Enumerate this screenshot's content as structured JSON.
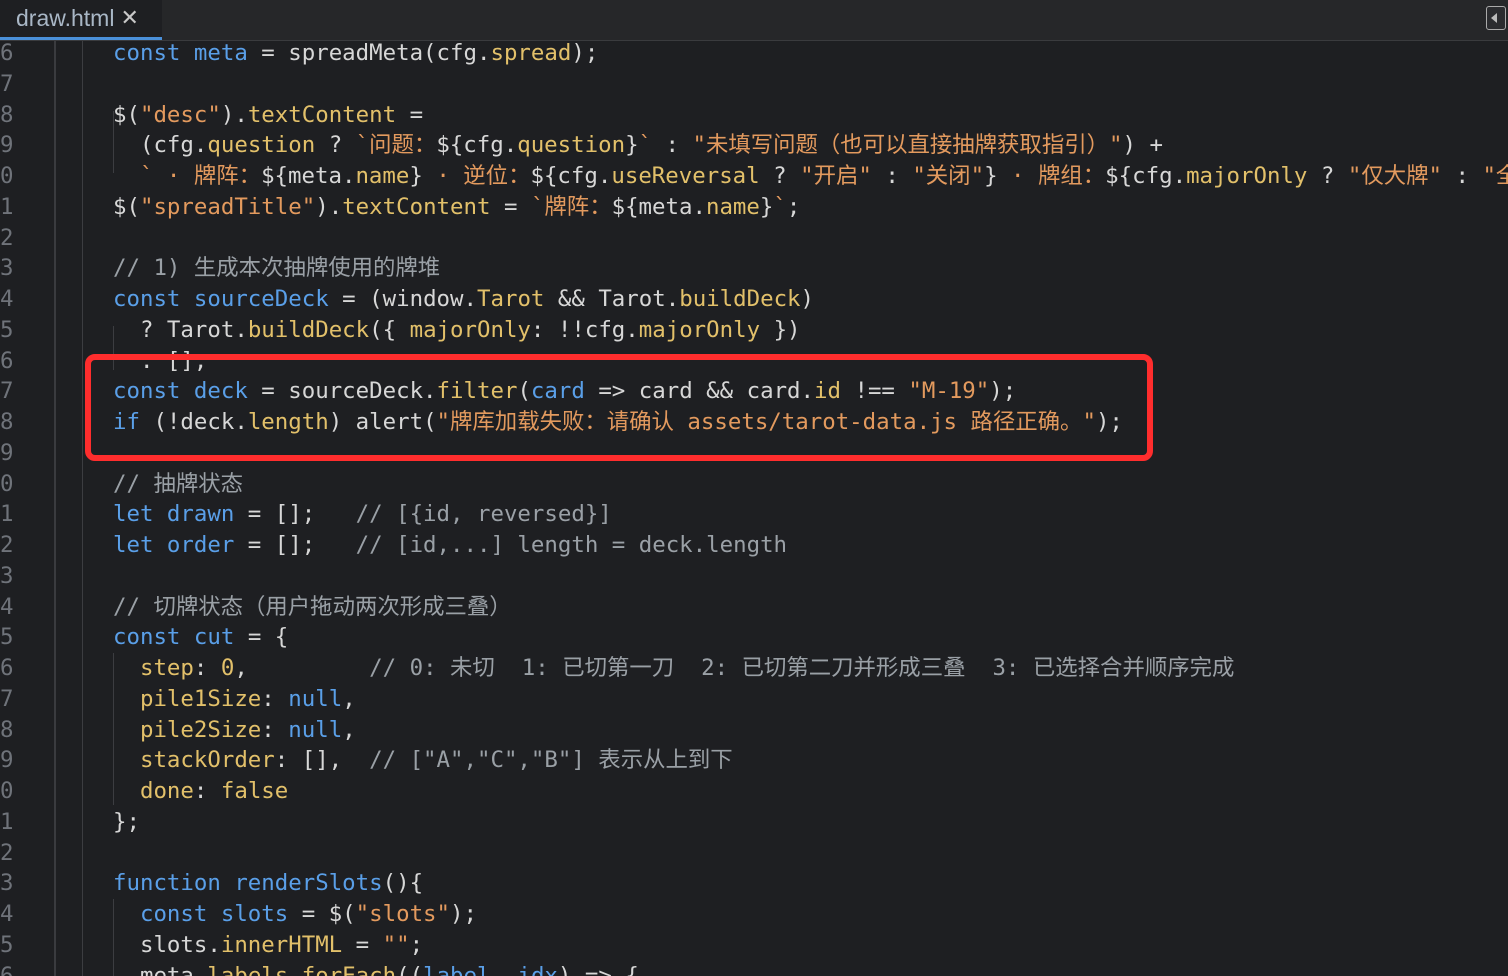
{
  "tab": {
    "title": "draw.html",
    "close_glyph": "✕"
  },
  "panel_toggle_icon": "collapse-panel-icon",
  "colors": {
    "background": "#1e1f22",
    "keyword": "#5a9fe8",
    "property": "#e2c06a",
    "string": "#e39a5e",
    "comment": "#9aa0a6",
    "text": "#d7d7d7",
    "highlight_box": "#ff2d2d"
  },
  "highlight": {
    "covers_line_numbers": [
      "7",
      "8"
    ],
    "color": "#ff2d2d"
  },
  "lines": [
    {
      "n": "6",
      "tokens": [
        [
          "kw",
          "const "
        ],
        [
          "var",
          "meta"
        ],
        [
          "txt",
          " = spreadMeta(cfg."
        ],
        [
          "prop",
          "spread"
        ],
        [
          "txt",
          ");"
        ]
      ]
    },
    {
      "n": "7",
      "tokens": []
    },
    {
      "n": "8",
      "tokens": [
        [
          "txt",
          "$("
        ],
        [
          "str",
          "\"desc\""
        ],
        [
          "txt",
          ")."
        ],
        [
          "prop",
          "textContent"
        ],
        [
          "txt",
          " ="
        ]
      ]
    },
    {
      "n": "9",
      "tokens": [
        [
          "txt",
          "  (cfg."
        ],
        [
          "prop",
          "question"
        ],
        [
          "txt",
          " ? "
        ],
        [
          "str",
          "`问题："
        ],
        [
          "txt",
          "${cfg."
        ],
        [
          "prop",
          "question"
        ],
        [
          "txt",
          "}"
        ],
        [
          "str",
          "`"
        ],
        [
          "txt",
          " : "
        ],
        [
          "str",
          "\"未填写问题（也可以直接抽牌获取指引）\""
        ],
        [
          "txt",
          ") +"
        ]
      ]
    },
    {
      "n": "0",
      "tokens": [
        [
          "str",
          "  ` · 牌阵："
        ],
        [
          "txt",
          "${meta."
        ],
        [
          "prop",
          "name"
        ],
        [
          "txt",
          "}"
        ],
        [
          "str",
          " · 逆位："
        ],
        [
          "txt",
          "${cfg."
        ],
        [
          "prop",
          "useReversal"
        ],
        [
          "txt",
          " ? "
        ],
        [
          "str",
          "\"开启\""
        ],
        [
          "txt",
          " : "
        ],
        [
          "str",
          "\"关闭\""
        ],
        [
          "txt",
          "}"
        ],
        [
          "str",
          " · 牌组："
        ],
        [
          "txt",
          "${cfg."
        ],
        [
          "prop",
          "majorOnly"
        ],
        [
          "txt",
          " ? "
        ],
        [
          "str",
          "\"仅大牌\""
        ],
        [
          "txt",
          " : "
        ],
        [
          "str",
          "\"全牌"
        ]
      ]
    },
    {
      "n": "1",
      "tokens": [
        [
          "txt",
          "$("
        ],
        [
          "str",
          "\"spreadTitle\""
        ],
        [
          "txt",
          ")."
        ],
        [
          "prop",
          "textContent"
        ],
        [
          "txt",
          " = "
        ],
        [
          "str",
          "`牌阵："
        ],
        [
          "txt",
          "${meta."
        ],
        [
          "prop",
          "name"
        ],
        [
          "txt",
          "}"
        ],
        [
          "str",
          "`"
        ],
        [
          "txt",
          ";"
        ]
      ]
    },
    {
      "n": "2",
      "tokens": []
    },
    {
      "n": "3",
      "tokens": [
        [
          "com",
          "// 1) 生成本次抽牌使用的牌堆"
        ]
      ]
    },
    {
      "n": "4",
      "tokens": [
        [
          "kw",
          "const "
        ],
        [
          "var",
          "sourceDeck"
        ],
        [
          "txt",
          " = (window."
        ],
        [
          "prop",
          "Tarot"
        ],
        [
          "txt",
          " && Tarot."
        ],
        [
          "prop",
          "buildDeck"
        ],
        [
          "txt",
          ")"
        ]
      ]
    },
    {
      "n": "5",
      "tokens": [
        [
          "txt",
          "  ? Tarot."
        ],
        [
          "prop",
          "buildDeck"
        ],
        [
          "txt",
          "({ "
        ],
        [
          "prop",
          "majorOnly"
        ],
        [
          "txt",
          ": !!cfg."
        ],
        [
          "prop",
          "majorOnly"
        ],
        [
          "txt",
          " })"
        ]
      ]
    },
    {
      "n": "6",
      "tokens": [
        [
          "txt",
          "  : [];"
        ]
      ]
    },
    {
      "n": "7",
      "tokens": [
        [
          "kw",
          "const "
        ],
        [
          "var",
          "deck"
        ],
        [
          "txt",
          " = sourceDeck."
        ],
        [
          "prop",
          "filter"
        ],
        [
          "txt",
          "("
        ],
        [
          "var",
          "card"
        ],
        [
          "txt",
          " => card && card."
        ],
        [
          "prop",
          "id"
        ],
        [
          "txt",
          " !== "
        ],
        [
          "str",
          "\"M-19\""
        ],
        [
          "txt",
          ");"
        ]
      ]
    },
    {
      "n": "8",
      "tokens": [
        [
          "kw",
          "if"
        ],
        [
          "txt",
          " (!deck."
        ],
        [
          "prop",
          "length"
        ],
        [
          "txt",
          ") alert("
        ],
        [
          "str",
          "\"牌库加载失败：请确认 assets/tarot-data.js 路径正确。\""
        ],
        [
          "txt",
          ");"
        ]
      ]
    },
    {
      "n": "9",
      "tokens": []
    },
    {
      "n": "0",
      "tokens": [
        [
          "com",
          "// 抽牌状态"
        ]
      ]
    },
    {
      "n": "1",
      "tokens": [
        [
          "kw",
          "let "
        ],
        [
          "var",
          "drawn"
        ],
        [
          "txt",
          " = [];   "
        ],
        [
          "com",
          "// [{id, reversed}]"
        ]
      ]
    },
    {
      "n": "2",
      "tokens": [
        [
          "kw",
          "let "
        ],
        [
          "var",
          "order"
        ],
        [
          "txt",
          " = [];   "
        ],
        [
          "com",
          "// [id,...] length = deck.length"
        ]
      ]
    },
    {
      "n": "3",
      "tokens": []
    },
    {
      "n": "4",
      "tokens": [
        [
          "com",
          "// 切牌状态（用户拖动两次形成三叠）"
        ]
      ]
    },
    {
      "n": "5",
      "tokens": [
        [
          "kw",
          "const "
        ],
        [
          "var",
          "cut"
        ],
        [
          "txt",
          " = {"
        ]
      ]
    },
    {
      "n": "6",
      "tokens": [
        [
          "prop",
          "  step"
        ],
        [
          "txt",
          ": "
        ],
        [
          "num",
          "0"
        ],
        [
          "txt",
          ",         "
        ],
        [
          "com",
          "// 0: 未切  1: 已切第一刀  2: 已切第二刀并形成三叠  3: 已选择合并顺序完成"
        ]
      ]
    },
    {
      "n": "7",
      "tokens": [
        [
          "prop",
          "  pile1Size"
        ],
        [
          "txt",
          ": "
        ],
        [
          "kw",
          "null"
        ],
        [
          "txt",
          ","
        ]
      ]
    },
    {
      "n": "8",
      "tokens": [
        [
          "prop",
          "  pile2Size"
        ],
        [
          "txt",
          ": "
        ],
        [
          "kw",
          "null"
        ],
        [
          "txt",
          ","
        ]
      ]
    },
    {
      "n": "9",
      "tokens": [
        [
          "prop",
          "  stackOrder"
        ],
        [
          "txt",
          ": [],  "
        ],
        [
          "com",
          "// [\"A\",\"C\",\"B\"] 表示从上到下"
        ]
      ]
    },
    {
      "n": "0",
      "tokens": [
        [
          "prop",
          "  done"
        ],
        [
          "txt",
          ": "
        ],
        [
          "prop",
          "false"
        ]
      ]
    },
    {
      "n": "1",
      "tokens": [
        [
          "txt",
          "};"
        ]
      ]
    },
    {
      "n": "2",
      "tokens": []
    },
    {
      "n": "3",
      "tokens": [
        [
          "kw",
          "function "
        ],
        [
          "fn",
          "renderSlots"
        ],
        [
          "txt",
          "(){"
        ]
      ]
    },
    {
      "n": "4",
      "tokens": [
        [
          "kw",
          "  const "
        ],
        [
          "var",
          "slots"
        ],
        [
          "txt",
          " = $("
        ],
        [
          "str",
          "\"slots\""
        ],
        [
          "txt",
          ");"
        ]
      ]
    },
    {
      "n": "5",
      "tokens": [
        [
          "txt",
          "  slots."
        ],
        [
          "prop",
          "innerHTML"
        ],
        [
          "txt",
          " = "
        ],
        [
          "str",
          "\"\""
        ],
        [
          "txt",
          ";"
        ]
      ]
    },
    {
      "n": "6",
      "tokens": [
        [
          "txt",
          "  meta."
        ],
        [
          "prop",
          "labels"
        ],
        [
          "txt",
          "."
        ],
        [
          "prop",
          "forEach"
        ],
        [
          "txt",
          "(("
        ],
        [
          "var",
          "label"
        ],
        [
          "txt",
          ", "
        ],
        [
          "var",
          "idx"
        ],
        [
          "txt",
          ") => {"
        ]
      ]
    }
  ]
}
